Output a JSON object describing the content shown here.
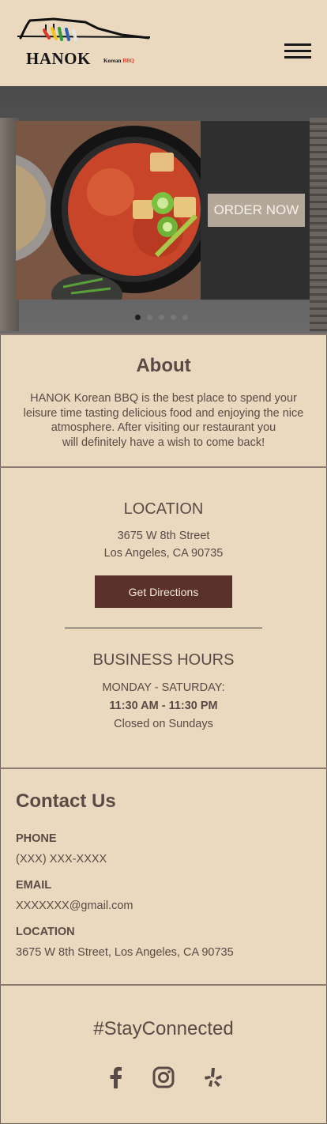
{
  "header": {
    "logo_text": "HANOK",
    "logo_sub_korean": "Korean",
    "logo_sub_bbq": "BBQ",
    "menu_icon": "hamburger-menu-icon"
  },
  "hero": {
    "order_label": "ORDER NOW",
    "slide_count": 5,
    "active_slide": 1
  },
  "about": {
    "title": "About",
    "lines": [
      "HANOK Korean BBQ is the best place to spend your",
      "leisure time tasting delicious food and enjoying the nice",
      "atmosphere. After visiting our restaurant you",
      "will definitely have a wish to come back!"
    ]
  },
  "location": {
    "title": "LOCATION",
    "street": "3675 W 8th Street",
    "city": "Los Angeles, CA 90735",
    "directions_label": "Get Directions"
  },
  "hours": {
    "title": "BUSINESS HOURS",
    "days": "MONDAY - SATURDAY:",
    "time": "11:30 AM - 11:30 PM",
    "closed": "Closed on Sundays"
  },
  "contact": {
    "title": "Contact Us",
    "phone_label": "PHONE",
    "phone_value": "(XXX) XXX-XXXX",
    "email_label": "EMAIL",
    "email_value": "XXXXXXX@gmail.com",
    "location_label": "LOCATION",
    "location_value": "3675 W 8th Street, Los Angeles, CA 90735"
  },
  "footer": {
    "title": "#StayConnected",
    "icons": [
      "facebook-icon",
      "instagram-icon",
      "yelp-icon"
    ]
  },
  "colors": {
    "background": "#ebd9bf",
    "text": "#5a4a45",
    "button": "#5a302a",
    "order_button": "#b3a797"
  }
}
